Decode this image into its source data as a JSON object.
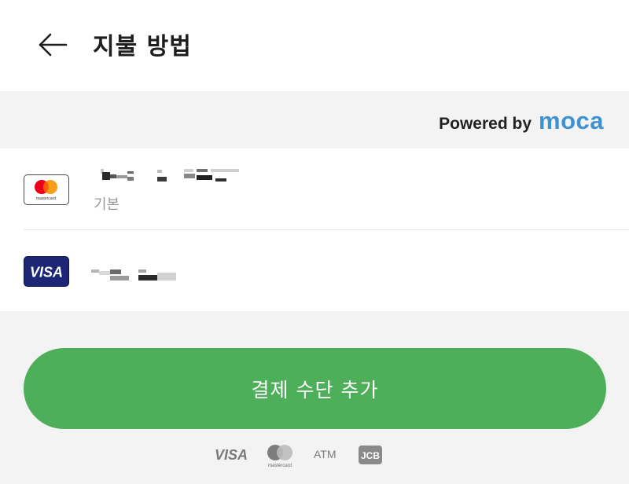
{
  "header": {
    "title": "지불 방법",
    "back_icon": "arrow-left-icon"
  },
  "powered": {
    "prefix": "Powered by",
    "brand": "moca",
    "brand_color": "#3f92d2"
  },
  "payment_methods": [
    {
      "brand": "mastercard",
      "brand_label": "mastercard",
      "number": "redacted",
      "badge": "기본"
    },
    {
      "brand": "visa",
      "brand_label": "VISA",
      "number": "redacted"
    }
  ],
  "add_button": {
    "label": "결제 수단 추가",
    "color": "#4daf59"
  },
  "accepted_brands": {
    "visa": "VISA",
    "mastercard": "mastercard",
    "atm": "ATM",
    "jcb": "JCB"
  }
}
